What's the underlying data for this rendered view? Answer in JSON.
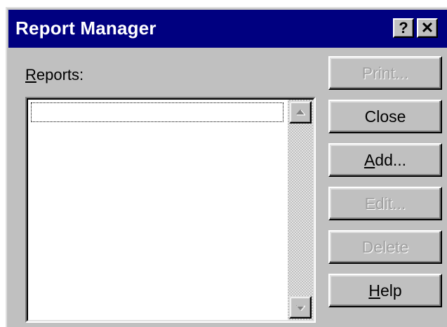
{
  "window": {
    "title": "Report Manager",
    "help_label": "?",
    "close_label": "✕"
  },
  "reports_label": "Reports:",
  "reports_list": [],
  "buttons": {
    "print": "Print...",
    "close": "Close",
    "add": "Add...",
    "edit": "Edit...",
    "delete": "Delete",
    "help": "Help"
  },
  "button_states": {
    "print": "disabled",
    "close": "enabled",
    "add": "enabled",
    "edit": "disabled",
    "delete": "disabled",
    "help": "enabled"
  },
  "colors": {
    "titlebar": "#000080",
    "face": "#c0c0c0",
    "disabled_text": "#a0a0a0"
  },
  "icons": [
    "help-icon",
    "close-icon",
    "scroll-up-icon",
    "scroll-down-icon"
  ]
}
